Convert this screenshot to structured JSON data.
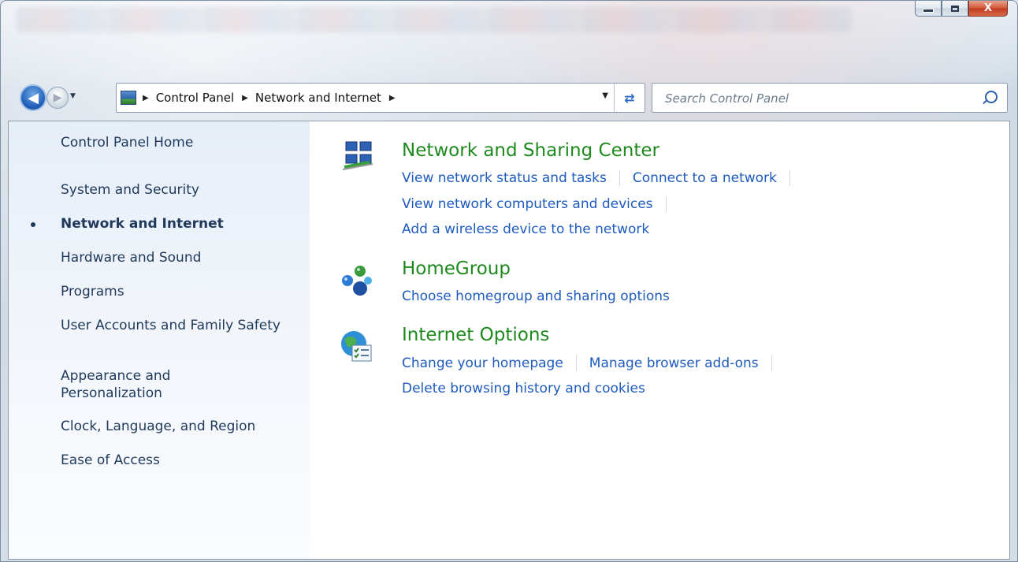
{
  "window": {
    "minimize": "minimize",
    "maximize": "maximize",
    "close": "X"
  },
  "address_bar": {
    "breadcrumbs": [
      "Control Panel",
      "Network and Internet"
    ]
  },
  "search": {
    "placeholder": "Search Control Panel"
  },
  "sidebar": {
    "items": [
      {
        "label": "Control Panel Home"
      },
      {
        "label": "System and Security"
      },
      {
        "label": "Network and Internet",
        "active": true
      },
      {
        "label": "Hardware and Sound"
      },
      {
        "label": "Programs"
      },
      {
        "label": "User Accounts and Family Safety"
      },
      {
        "label": "Appearance and Personalization"
      },
      {
        "label": "Clock, Language, and Region"
      },
      {
        "label": "Ease of Access"
      }
    ]
  },
  "categories": [
    {
      "title": "Network and Sharing Center",
      "icon": "network-sharing-icon",
      "links": [
        [
          "View network status and tasks",
          "Connect to a network"
        ],
        [
          "View network computers and devices"
        ],
        [
          "Add a wireless device to the network"
        ]
      ]
    },
    {
      "title": "HomeGroup",
      "icon": "homegroup-icon",
      "links": [
        [
          "Choose homegroup and sharing options"
        ]
      ]
    },
    {
      "title": "Internet Options",
      "icon": "internet-options-icon",
      "links": [
        [
          "Change your homepage",
          "Manage browser add-ons"
        ],
        [
          "Delete browsing history and cookies"
        ]
      ]
    }
  ],
  "colors": {
    "category_title": "#1e8a1e",
    "link": "#1e5bbd",
    "sidebar_text": "#1e395b"
  }
}
